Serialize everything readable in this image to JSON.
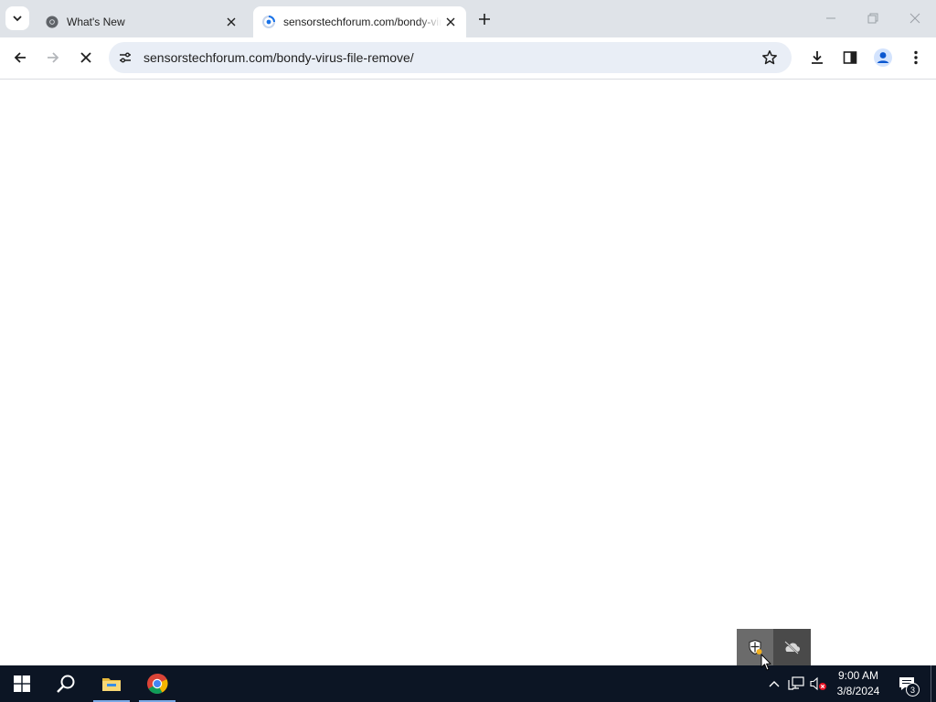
{
  "browser": {
    "tabs": [
      {
        "title": "What's New",
        "favicon": "chrome-icon",
        "active": false
      },
      {
        "title": "sensorstechforum.com/bondy-virus-file-remove/",
        "favicon": "loading-spinner-icon",
        "active": true
      }
    ],
    "url": "sensorstechforum.com/bondy-virus-file-remove/"
  },
  "taskbar": {
    "pinned": [
      "windows-start-icon",
      "search-icon",
      "file-explorer-icon",
      "chrome-icon"
    ],
    "tray_popup_icons": [
      "windows-security-icon",
      "onedrive-offline-icon"
    ],
    "clock": {
      "time": "9:00 AM",
      "date": "3/8/2024"
    },
    "notification_count": "3"
  },
  "colors": {
    "tabstrip": "#dfe3e8",
    "omnibox": "#e9eef6",
    "taskbar": "#0c1524",
    "accent": "#1a73e8"
  }
}
